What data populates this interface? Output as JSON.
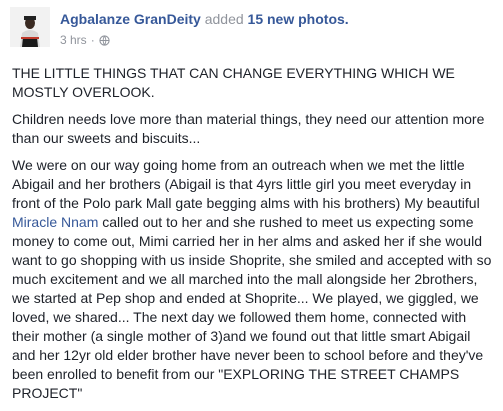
{
  "post": {
    "author": "Agbalanze GranDeity",
    "action_prefix": "added",
    "action_count": "15 new photos.",
    "time": "3 hrs",
    "visibility_icon": "globe-icon",
    "title": "THE LITTLE THINGS THAT CAN CHANGE EVERYTHING WHICH WE MOSTLY OVERLOOK.",
    "paragraph_2": "Children needs love more than material things, they need our attention more than our sweets and biscuits...",
    "paragraph_3_before_mention": "We were on our way going home from an outreach when we met the little Abigail and her brothers (Abigail is that 4yrs little girl you meet everyday in front of the Polo park Mall gate begging alms with his brothers) My beautiful ",
    "mention": "Miracle Nnam",
    "paragraph_3_after_mention": " called out to her and she rushed to meet us expecting some money to come out, Mimi carried her in her alms and asked her if she would want to go shopping with us inside Shoprite, she smiled and accepted with so much excitement and we all marched into the mall alongside her 2brothers, we started at Pep shop and ended at Shoprite... We played, we giggled, we loved, we shared... The next day we followed them home, connected with their mother (a single mother of 3)and we found out that little smart Abigail and her 12yr old elder brother have never been to school before and they've been enrolled to benefit from our \"EXPLORING THE STREET CHAMPS PROJECT\""
  },
  "colors": {
    "link": "#365899",
    "meta": "#90949c",
    "text": "#1d2129"
  }
}
